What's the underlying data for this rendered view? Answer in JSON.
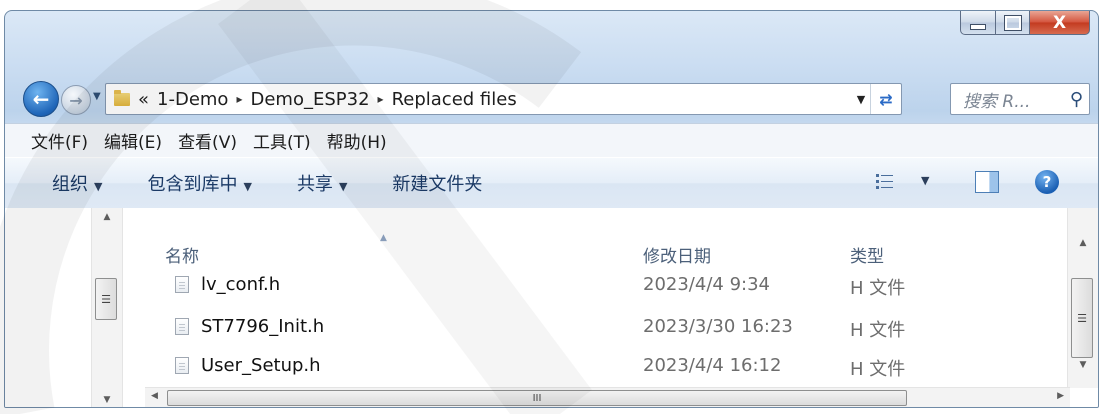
{
  "window": {
    "minimize_label": "—",
    "maximize_label": "▢",
    "close_label": "X"
  },
  "address": {
    "overflow": "«",
    "crumbs": [
      "1-Demo",
      "Demo_ESP32",
      "Replaced files"
    ],
    "separator": "▸",
    "search_placeholder": "搜索 R..."
  },
  "menu": [
    "文件(F)",
    "编辑(E)",
    "查看(V)",
    "工具(T)",
    "帮助(H)"
  ],
  "commands": {
    "organize": "组织",
    "include_in_library": "包含到库中",
    "share": "共享",
    "new_folder": "新建文件夹"
  },
  "columns": {
    "name": "名称",
    "date_modified": "修改日期",
    "type": "类型"
  },
  "files": [
    {
      "name": "lv_conf.h",
      "date": "2023/4/4 9:34",
      "type": "H 文件"
    },
    {
      "name": "ST7796_Init.h",
      "date": "2023/3/30 16:23",
      "type": "H 文件"
    },
    {
      "name": "User_Setup.h",
      "date": "2023/4/4 16:12",
      "type": "H 文件"
    }
  ],
  "scrollbar": {
    "thumb_grip_v": "☰",
    "thumb_grip_h": "III"
  },
  "colors": {
    "accent": "#1f65b8",
    "close_button": "#c23a20"
  }
}
